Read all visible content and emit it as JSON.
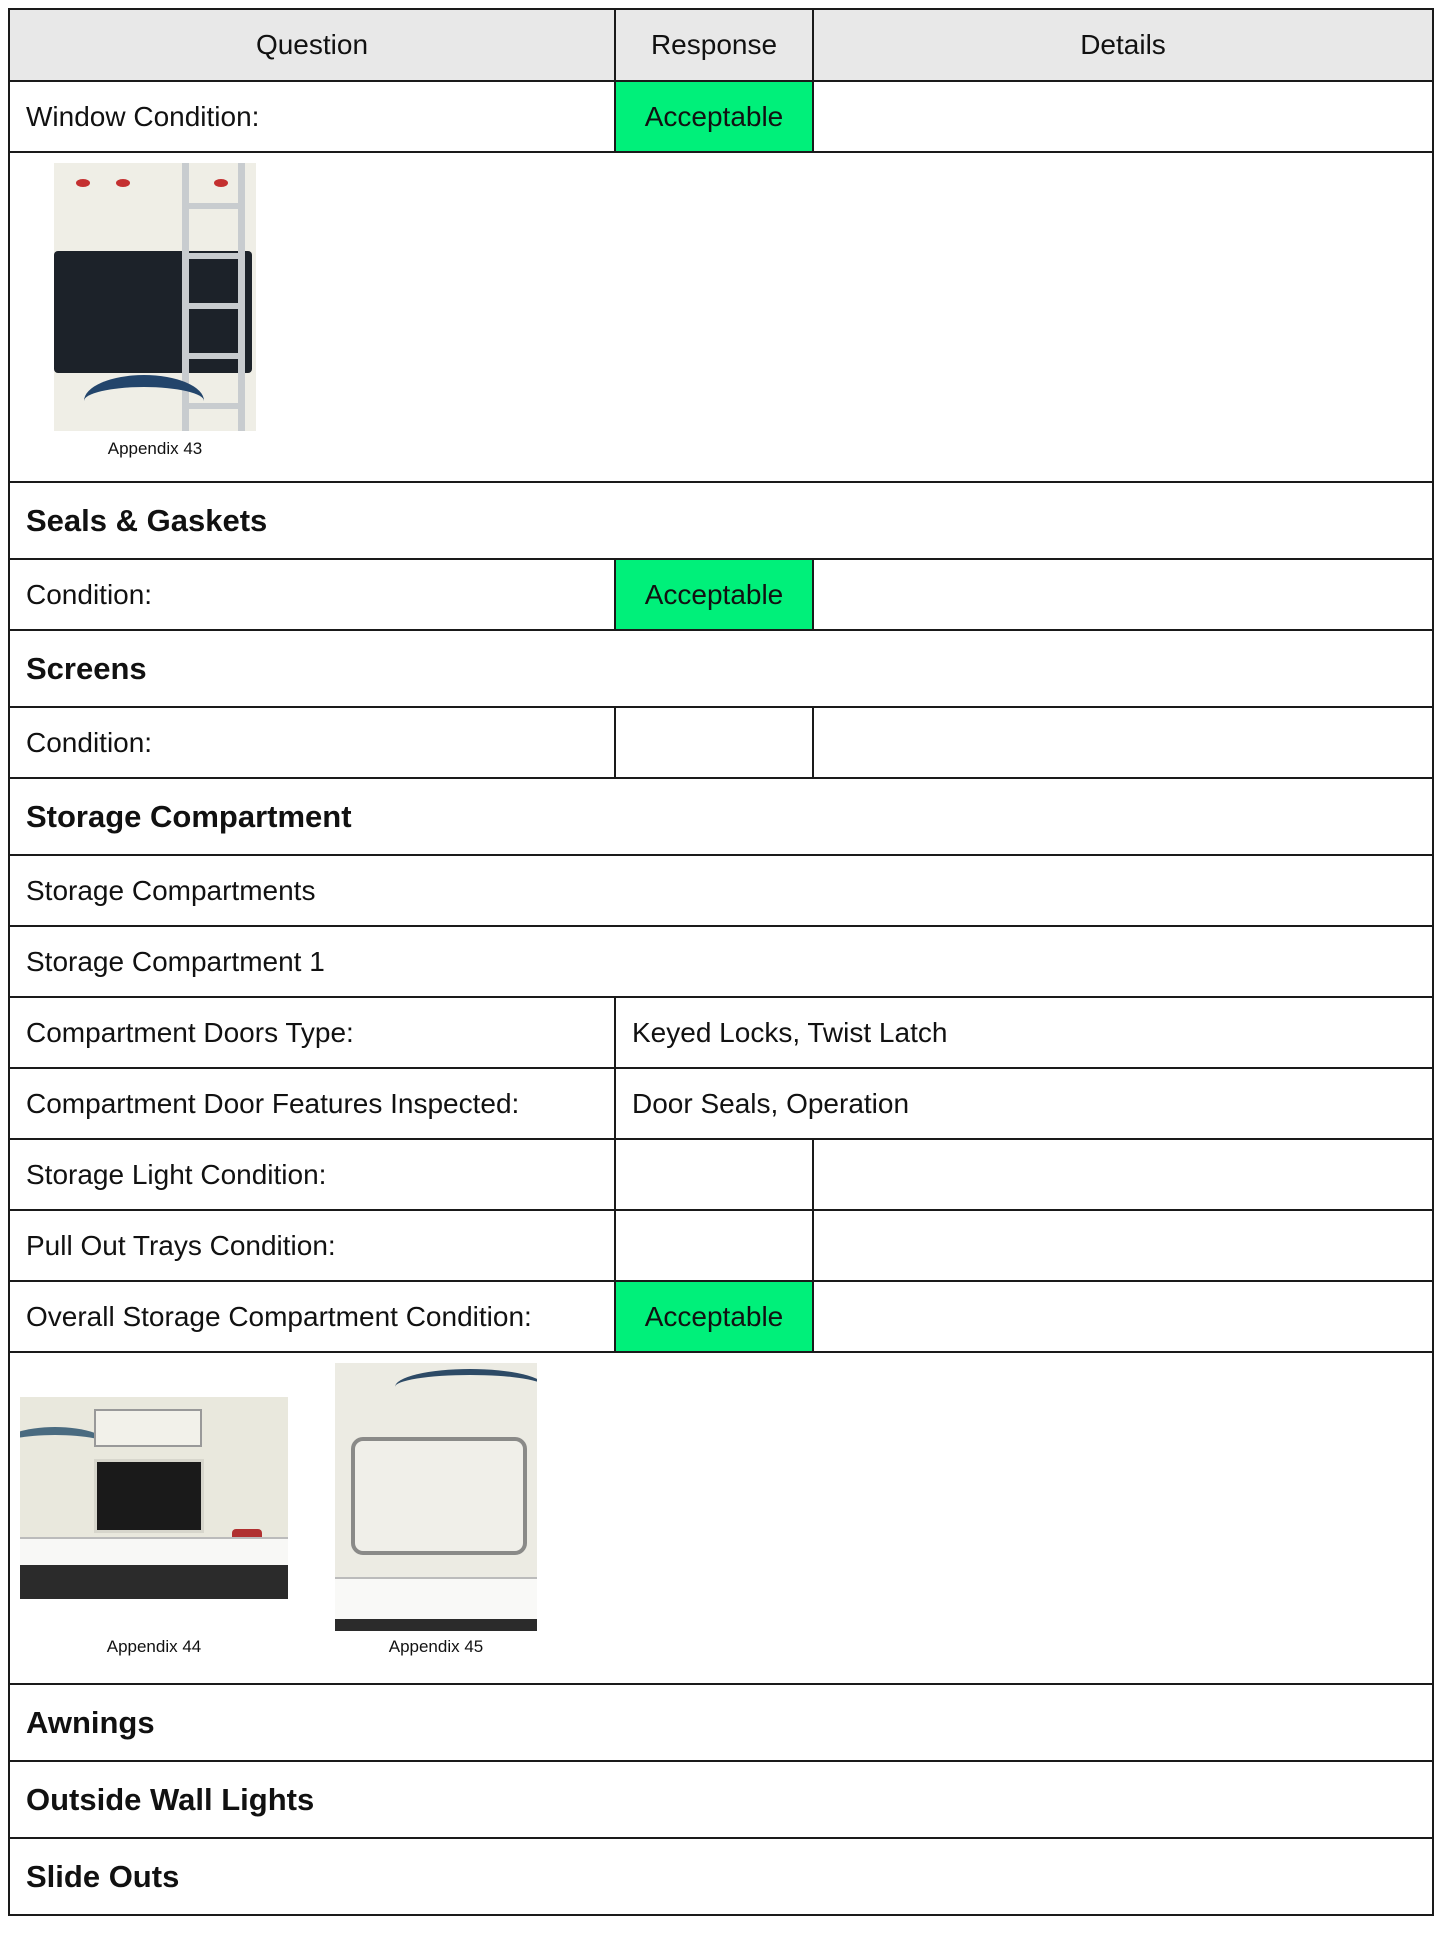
{
  "table": {
    "headers": [
      "Question",
      "Response",
      "Details"
    ]
  },
  "rows": {
    "window_condition": {
      "question": "Window Condition:",
      "response": "Acceptable",
      "details": ""
    },
    "appendix_43": "Appendix 43",
    "seals_gaskets": "Seals & Gaskets",
    "seals_condition": {
      "question": "Condition:",
      "response": "Acceptable",
      "details": ""
    },
    "screens": "Screens",
    "screens_condition": {
      "question": "Condition:",
      "response": "",
      "details": ""
    },
    "storage_compartment": "Storage Compartment",
    "storage_compartments": "Storage Compartments",
    "storage_compartment_1": "Storage Compartment 1",
    "doors_type": {
      "question": "Compartment Doors Type:",
      "value": "Keyed Locks, Twist Latch"
    },
    "door_features": {
      "question": "Compartment Door Features Inspected:",
      "value": "Door Seals, Operation"
    },
    "storage_light": {
      "question": "Storage Light Condition:",
      "response": "",
      "details": ""
    },
    "pull_out_trays": {
      "question": "Pull Out Trays Condition:",
      "response": "",
      "details": ""
    },
    "overall_storage": {
      "question": "Overall Storage Compartment Condition:",
      "response": "Acceptable",
      "details": ""
    },
    "appendix_44": "Appendix 44",
    "appendix_45": "Appendix 45",
    "awnings": "Awnings",
    "outside_wall_lights": "Outside Wall Lights",
    "slide_outs": "Slide Outs"
  },
  "colors": {
    "acceptable_bg": "#00f07a",
    "header_bg": "#e8e8e8"
  }
}
